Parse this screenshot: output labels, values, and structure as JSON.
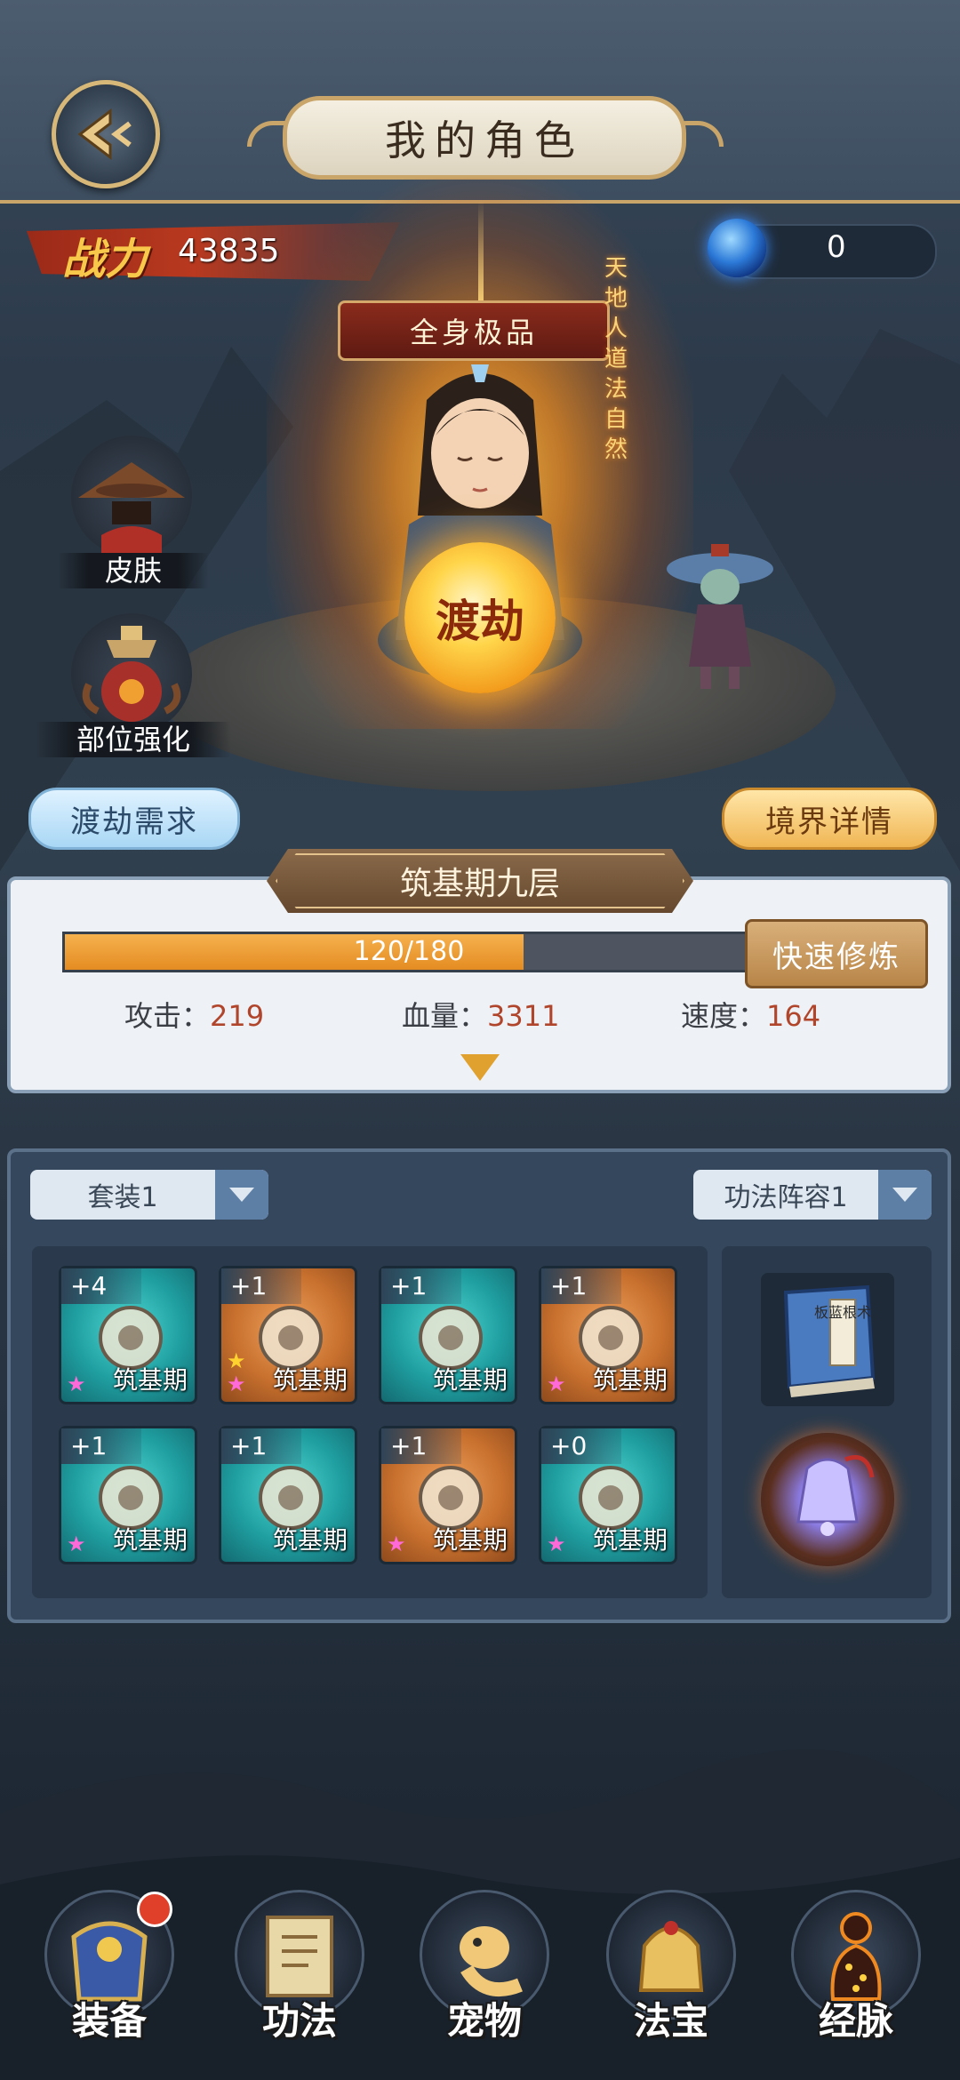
{
  "header": {
    "title": "我的角色"
  },
  "power": {
    "label": "战力",
    "value": "43835"
  },
  "currency": {
    "value": "0"
  },
  "scene": {
    "quality_banner": "全身极品",
    "orb_label": "渡劫",
    "vertical_text": "天地人道法自然"
  },
  "side_buttons": {
    "skin": "皮肤",
    "enhance": "部位强化"
  },
  "actions": {
    "requirements": "渡劫需求",
    "realm_details": "境界详情"
  },
  "realm": {
    "title": "筑基期九层",
    "progress_text": "120/180",
    "progress_current": 120,
    "progress_max": 180,
    "quick_cultivate": "快速修炼",
    "stats": [
      {
        "label": "攻击：",
        "value": "219"
      },
      {
        "label": "血量：",
        "value": "3311"
      },
      {
        "label": "速度：",
        "value": "164"
      }
    ]
  },
  "equipment": {
    "set_dropdown": "套装1",
    "skill_dropdown": "功法阵容1",
    "slots": [
      {
        "level": "+4",
        "stage": "筑基期",
        "rarity": "teal",
        "item": "dagger",
        "stars": [
          "pink"
        ]
      },
      {
        "level": "+1",
        "stage": "筑基期",
        "rarity": "orange",
        "item": "armor",
        "stars": [
          "pink",
          "gold"
        ]
      },
      {
        "level": "+1",
        "stage": "筑基期",
        "rarity": "teal",
        "item": "skull-helmet",
        "stars": []
      },
      {
        "level": "+1",
        "stage": "筑基期",
        "rarity": "orange",
        "item": "boots",
        "stars": [
          "pink"
        ]
      },
      {
        "level": "+1",
        "stage": "筑基期",
        "rarity": "teal",
        "item": "necklace",
        "stars": [
          "pink"
        ]
      },
      {
        "level": "+1",
        "stage": "筑基期",
        "rarity": "teal",
        "item": "belt",
        "stars": []
      },
      {
        "level": "+1",
        "stage": "筑基期",
        "rarity": "orange",
        "item": "bracelet",
        "stars": [
          "pink"
        ]
      },
      {
        "level": "+0",
        "stage": "筑基期",
        "rarity": "teal",
        "item": "ring",
        "stars": [
          "pink"
        ]
      }
    ],
    "book_title": "板蓝根术"
  },
  "nav": [
    {
      "label": "装备",
      "icon": "armor-icon",
      "badge": true
    },
    {
      "label": "功法",
      "icon": "scroll-icon",
      "badge": false
    },
    {
      "label": "宠物",
      "icon": "dragon-icon",
      "badge": false
    },
    {
      "label": "法宝",
      "icon": "bell-icon",
      "badge": false
    },
    {
      "label": "经脉",
      "icon": "meridian-icon",
      "badge": false
    }
  ],
  "colors": {
    "accent_gold": "#c9a56a",
    "stat_value": "#b0452c",
    "xp_fill": "#e48c22"
  }
}
